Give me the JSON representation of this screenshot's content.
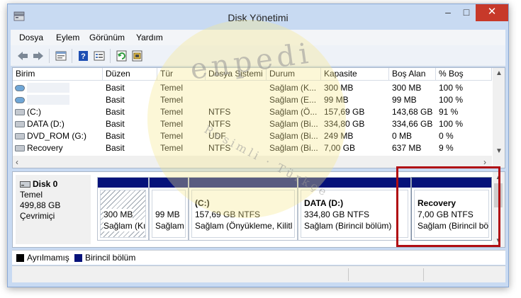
{
  "window": {
    "title": "Disk Yönetimi",
    "minimize": "–",
    "maximize": "□",
    "close": "✕"
  },
  "menu": [
    "Dosya",
    "Eylem",
    "Görünüm",
    "Yardım"
  ],
  "toolbar_icons": [
    "back-icon",
    "forward-icon",
    "properties-icon",
    "help-icon",
    "list-view-icon",
    "refresh-icon",
    "settings-icon"
  ],
  "table": {
    "columns": [
      "Birim",
      "Düzen",
      "Tür",
      "Dosya Sistemi",
      "Durum",
      "Kapasite",
      "Boş Alan",
      "% Boş"
    ],
    "rows": [
      [
        "",
        "Basit",
        "Temel",
        "",
        "Sağlam (K...",
        "300 MB",
        "300 MB",
        "100 %"
      ],
      [
        "",
        "Basit",
        "Temel",
        "",
        "Sağlam (E...",
        "99 MB",
        "99 MB",
        "100 %"
      ],
      [
        "(C:)",
        "Basit",
        "Temel",
        "NTFS",
        "Sağlam (Ö...",
        "157,69 GB",
        "143,68 GB",
        "91 %"
      ],
      [
        "DATA (D:)",
        "Basit",
        "Temel",
        "NTFS",
        "Sağlam (Bi...",
        "334,80 GB",
        "334,66 GB",
        "100 %"
      ],
      [
        "DVD_ROM (G:)",
        "Basit",
        "Temel",
        "UDF",
        "Sağlam (Bi...",
        "249 MB",
        "0 MB",
        "0 %"
      ],
      [
        "Recovery",
        "Basit",
        "Temel",
        "NTFS",
        "Sağlam (Bi...",
        "7,00 GB",
        "637 MB",
        "9 %"
      ]
    ]
  },
  "disk": {
    "name": "Disk 0",
    "type": "Temel",
    "size": "499,88 GB",
    "status": "Çevrimiçi",
    "partitions": [
      {
        "title": "",
        "size": "300 MB",
        "status": "Sağlam (Kı"
      },
      {
        "title": "",
        "size": "99 MB",
        "status": "Sağlam"
      },
      {
        "title": "(C:)",
        "size": "157,69 GB NTFS",
        "status": "Sağlam (Önyükleme, Kilitl"
      },
      {
        "title": "DATA  (D:)",
        "size": "334,80 GB NTFS",
        "status": "Sağlam (Birincil bölüm)"
      },
      {
        "title": "Recovery",
        "size": "7,00 GB NTFS",
        "status": "Sağlam (Birincil bö"
      }
    ]
  },
  "legend": [
    {
      "label": "Ayrılmamış",
      "color": "#000000"
    },
    {
      "label": "Birincil bölüm",
      "color": "#06127a"
    }
  ],
  "colors": {
    "partition_header": "#06127a",
    "highlight": "#b00d13",
    "close_button": "#c7392a"
  },
  "watermark": {
    "brand": "enpedi",
    "tagline": "Resimli · Türkçe"
  }
}
